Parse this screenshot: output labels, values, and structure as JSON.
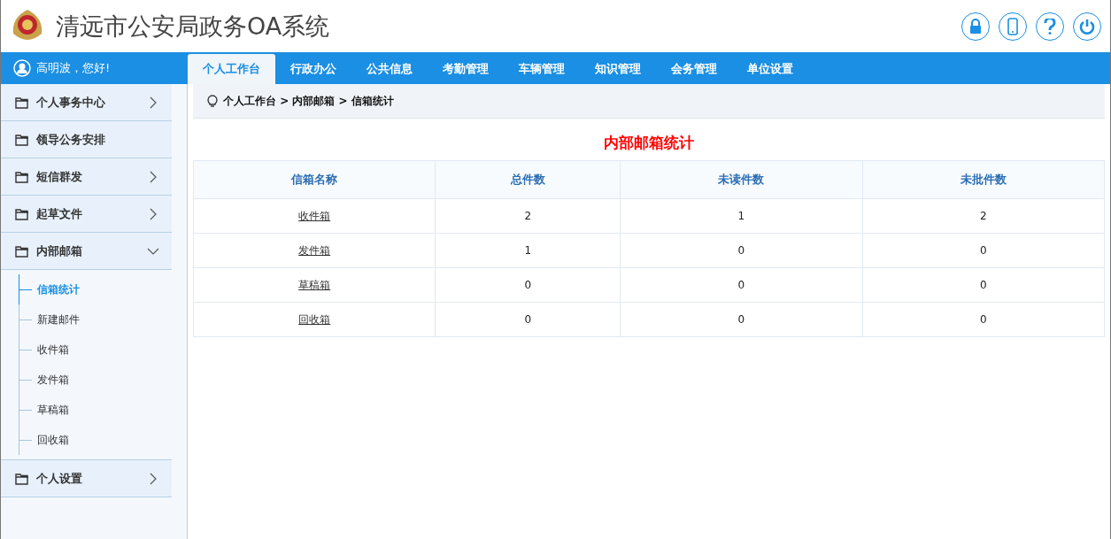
{
  "header": {
    "title": "清远市公安局政务OA系统"
  },
  "user": {
    "greeting": "高明波，您好!"
  },
  "tabs": [
    {
      "label": "个人工作台",
      "selected": true
    },
    {
      "label": "行政办公",
      "selected": false
    },
    {
      "label": "公共信息",
      "selected": false
    },
    {
      "label": "考勤管理",
      "selected": false
    },
    {
      "label": "车辆管理",
      "selected": false
    },
    {
      "label": "知识管理",
      "selected": false
    },
    {
      "label": "会务管理",
      "selected": false
    },
    {
      "label": "单位设置",
      "selected": false
    }
  ],
  "sidebar": {
    "items": [
      {
        "label": "个人事务中心",
        "kind": "group",
        "expanded": false
      },
      {
        "label": "领导公务安排",
        "kind": "link"
      },
      {
        "label": "短信群发",
        "kind": "group",
        "expanded": false
      },
      {
        "label": "起草文件",
        "kind": "group",
        "expanded": false
      },
      {
        "label": "内部邮箱",
        "kind": "group",
        "expanded": true,
        "children": [
          {
            "label": "信箱统计",
            "selected": true
          },
          {
            "label": "新建邮件",
            "selected": false
          },
          {
            "label": "收件箱",
            "selected": false
          },
          {
            "label": "发件箱",
            "selected": false
          },
          {
            "label": "草稿箱",
            "selected": false
          },
          {
            "label": "回收箱",
            "selected": false
          }
        ]
      },
      {
        "label": "个人设置",
        "kind": "group",
        "expanded": false
      }
    ]
  },
  "breadcrumb": "个人工作台 > 内部邮箱 > 信箱统计",
  "table": {
    "title": "内部邮箱统计",
    "columns": [
      "信箱名称",
      "总件数",
      "未读件数",
      "未批件数"
    ],
    "rows": [
      [
        "收件箱",
        "2",
        "1",
        "2"
      ],
      [
        "发件箱",
        "1",
        "0",
        "0"
      ],
      [
        "草稿箱",
        "0",
        "0",
        "0"
      ],
      [
        "回收箱",
        "0",
        "0",
        "0"
      ]
    ]
  }
}
